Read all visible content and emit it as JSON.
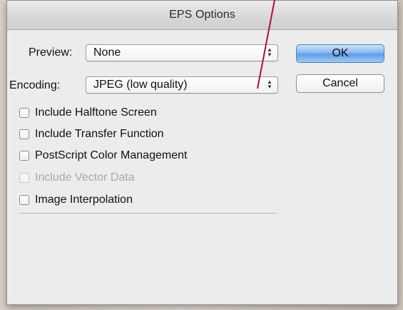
{
  "dialog": {
    "title": "EPS Options"
  },
  "preview": {
    "label": "Preview:",
    "value": "None"
  },
  "encoding": {
    "label": "Encoding:",
    "value": "JPEG  (low quality)"
  },
  "buttons": {
    "ok": "OK",
    "cancel": "Cancel"
  },
  "options": [
    {
      "label": "Include Halftone Screen",
      "checked": false,
      "enabled": true
    },
    {
      "label": "Include Transfer Function",
      "checked": false,
      "enabled": true
    },
    {
      "label": "PostScript Color Management",
      "checked": false,
      "enabled": true
    },
    {
      "label": "Include Vector Data",
      "checked": false,
      "enabled": false
    },
    {
      "label": "Image Interpolation",
      "checked": false,
      "enabled": true
    }
  ],
  "colors": {
    "annotation_line": "#b3112e",
    "default_button": "#6aa6ec"
  }
}
